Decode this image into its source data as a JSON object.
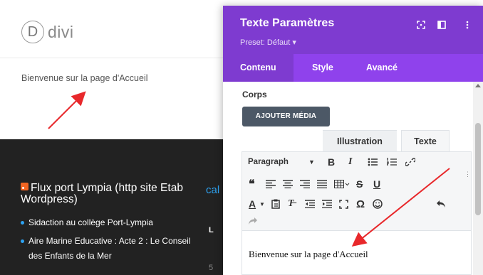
{
  "site": {
    "logo_letter": "D",
    "logo_text": "divi",
    "welcome_text": "Bienvenue sur la page d'Accueil",
    "feed_title": "Flux port Lympia (http site Etab Wordpress)",
    "feed_items": [
      "Sidaction au collège Port-Lympia",
      "Aire Marine Educative : Acte 2 : Le Conseil des Enfants de la Mer"
    ],
    "calendar_label": "cal",
    "calendar_day_header": "L",
    "calendar_day": "5"
  },
  "modal": {
    "title": "Texte Paramètres",
    "preset": "Preset: Défaut ▾",
    "icons": [
      "fullscreen-icon",
      "split-view-icon",
      "more-options-icon"
    ],
    "tabs": [
      {
        "label": "Contenu",
        "active": true
      },
      {
        "label": "Style",
        "active": false
      },
      {
        "label": "Avancé",
        "active": false
      }
    ],
    "section_label": "Corps",
    "add_media_label": "AJOUTER MÉDIA",
    "editor_tabs": {
      "visual": "Illustration",
      "text": "Texte"
    },
    "toolbar": {
      "format_select": "Paragraph",
      "bold": "B",
      "italic": "I",
      "blockquote": "❝",
      "strikethrough": "S",
      "underline": "U",
      "text_color": "A",
      "special_char": "Ω"
    },
    "editor_content": "Bienvenue sur la page d'Accueil"
  },
  "colors": {
    "header_purple": "#7e3bd0",
    "tab_purple": "#8f42ec",
    "annotation_arrow": "#e8282b",
    "footer_dark": "#222222",
    "link_blue": "#2ea3f2"
  }
}
